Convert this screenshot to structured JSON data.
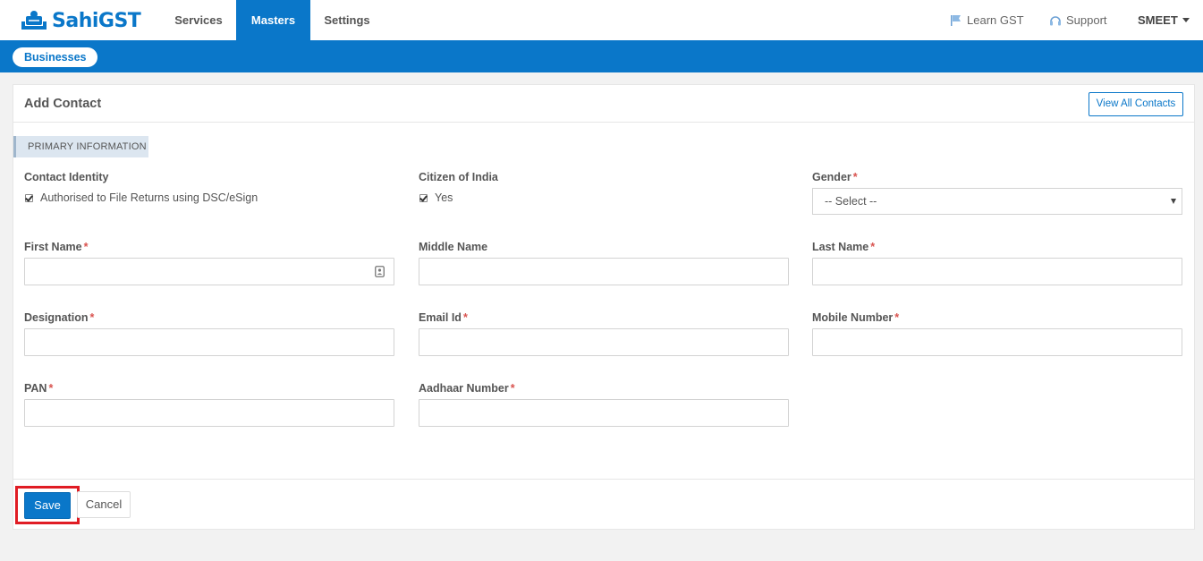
{
  "app": {
    "name": "SahiGST",
    "brand_color": "#0a77c9"
  },
  "nav": {
    "items": [
      {
        "label": "Services"
      },
      {
        "label": "Masters",
        "active": true
      },
      {
        "label": "Settings"
      }
    ],
    "learn_label": "Learn GST",
    "support_label": "Support",
    "user_label": "SMEET"
  },
  "subnav": {
    "pill_label": "Businesses"
  },
  "card": {
    "title": "Add Contact",
    "view_all_label": "View All Contacts",
    "section_label": "PRIMARY INFORMATION"
  },
  "form": {
    "contact_identity": {
      "label": "Contact Identity",
      "checkbox_label": "Authorised to File Returns using DSC/eSign",
      "checked": true
    },
    "citizen": {
      "label": "Citizen of India",
      "checkbox_label": "Yes",
      "checked": true
    },
    "gender": {
      "label": "Gender",
      "value": "-- Select --"
    },
    "first_name": {
      "label": "First Name",
      "value": ""
    },
    "middle_name": {
      "label": "Middle Name",
      "value": ""
    },
    "last_name": {
      "label": "Last Name",
      "value": ""
    },
    "designation": {
      "label": "Designation",
      "value": ""
    },
    "email": {
      "label": "Email Id",
      "value": ""
    },
    "mobile": {
      "label": "Mobile Number",
      "value": ""
    },
    "pan": {
      "label": "PAN",
      "value": ""
    },
    "aadhaar": {
      "label": "Aadhaar Number",
      "value": ""
    },
    "required_mark": "*"
  },
  "actions": {
    "save_label": "Save",
    "cancel_label": "Cancel",
    "highlight_color": "#e01c24"
  }
}
